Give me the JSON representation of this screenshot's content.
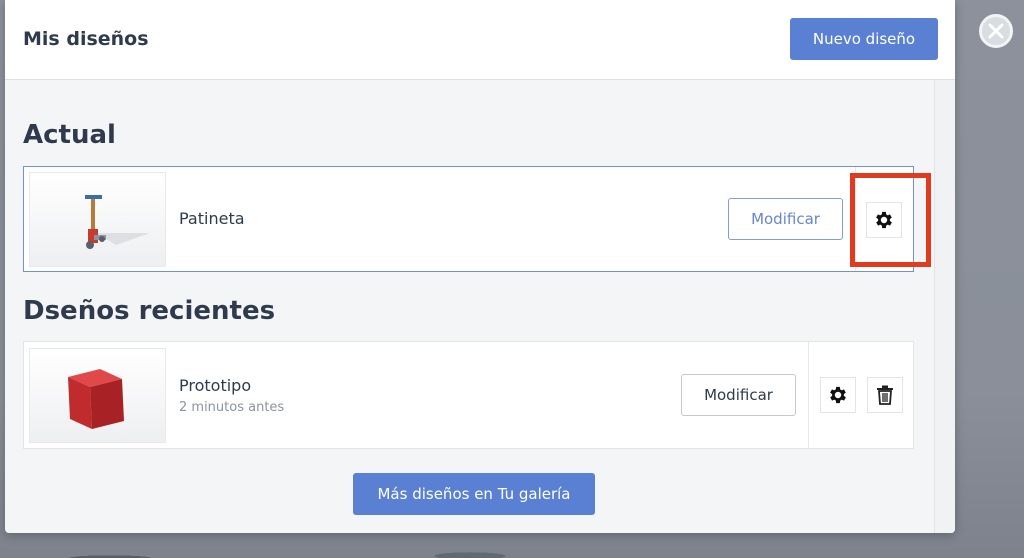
{
  "modal": {
    "title": "Mis diseños",
    "new_design_label": "Nuevo diseño",
    "close_icon": "close-icon"
  },
  "current_section": {
    "title": "Actual",
    "design": {
      "name": "Patineta",
      "modify_label": "Modificar",
      "settings_icon": "gear-icon",
      "thumbnail": "scooter-thumbnail"
    }
  },
  "recent_section": {
    "title": "Dseños recientes",
    "designs": [
      {
        "name": "Prototipo",
        "time": "2 minutos antes",
        "modify_label": "Modificar",
        "settings_icon": "gear-icon",
        "delete_icon": "trash-icon",
        "thumbnail": "red-cube-thumbnail"
      }
    ]
  },
  "footer": {
    "gallery_label": "Más diseños en Tu galería"
  },
  "colors": {
    "primary": "#5a80d3",
    "highlight": "#e03a1f",
    "text": "#2f3b4c"
  }
}
